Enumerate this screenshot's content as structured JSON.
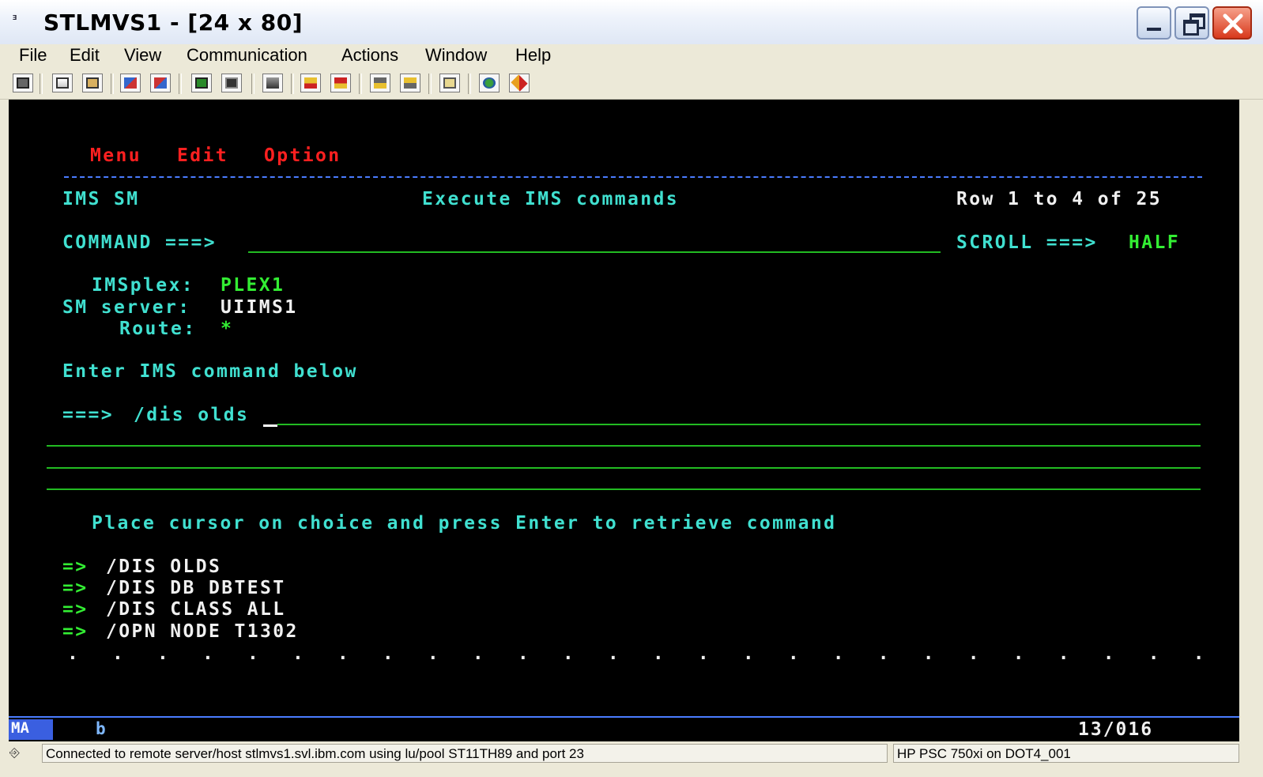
{
  "window": {
    "title": "STLMVS1 - [24 x 80]",
    "title_icon_glyph": "ᴲ"
  },
  "menubar": {
    "items": [
      "File",
      "Edit",
      "View",
      "Communication",
      "Actions",
      "Window",
      "Help"
    ]
  },
  "toolbar": {
    "icons": [
      "print-screen-icon",
      "copy-icon",
      "paste-icon",
      "send-file-icon",
      "receive-file-icon",
      "display-icon",
      "keypad-icon",
      "macro-icon",
      "record-macro-icon",
      "stop-macro-icon",
      "play-macro-icon",
      "pause-macro-icon",
      "clipboard-icon",
      "globe-icon",
      "help-icon"
    ]
  },
  "screen": {
    "action_bar": [
      "Menu",
      "Edit",
      "Option"
    ],
    "header_left": "IMS SM",
    "header_center": "Execute IMS commands",
    "header_right": "Row 1 to 4 of 25",
    "command_label": "COMMAND ===>",
    "command_value": "",
    "scroll_label": "SCROLL ===>",
    "scroll_value": "HALF",
    "imsplex_label": "IMSplex:",
    "imsplex_value": "PLEX1",
    "sm_server_label": "SM server:",
    "sm_server_value": "UIIMS1",
    "route_label": "Route:",
    "route_value": "*",
    "enter_prompt": "Enter IMS command below",
    "ims_prompt": "===>",
    "ims_command": "/dis olds",
    "instruction": "Place cursor on choice and press Enter to retrieve command",
    "history_marker": "=>",
    "history": [
      "/DIS OLDS",
      "/DIS DB DBTEST",
      "/DIS CLASS ALL",
      "/OPN NODE T1302"
    ],
    "dots": ".   .   .   .   .   .   .   .   .   .   .   .   .   .   .   .   .   .   .   .   .   .   .   .   .   .   ."
  },
  "oia": {
    "mode": "MA",
    "indicator": "b",
    "cursor_pos": "13/016"
  },
  "statusbar": {
    "connection": "Connected to remote server/host stlmvs1.svl.ibm.com using lu/pool ST11TH89 and port 23",
    "printer": "HP PSC 750xi on DOT4_001"
  }
}
